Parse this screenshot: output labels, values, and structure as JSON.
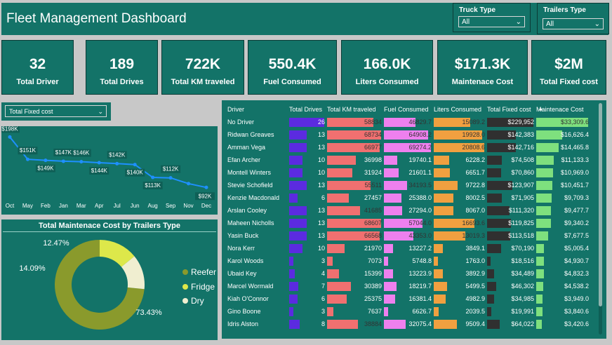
{
  "title": "Fleet Management Dashboard",
  "slicers": [
    {
      "label": "Truck Type",
      "value": "All"
    },
    {
      "label": "Trailers Type",
      "value": "All"
    }
  ],
  "cards": [
    {
      "value": "32",
      "label": "Total Driver"
    },
    {
      "value": "189",
      "label": "Total Drives"
    },
    {
      "value": "722K",
      "label": "Total  KM traveled"
    },
    {
      "value": "550.4K",
      "label": "Fuel Consumed"
    },
    {
      "value": "166.0K",
      "label": "Liters Consumed"
    },
    {
      "value": "$171.3K",
      "label": "Maintenace Cost"
    },
    {
      "value": "$2M",
      "label": "Total Fixed cost"
    }
  ],
  "measure_selector": {
    "value": "Total Fixed cost"
  },
  "chart_data": [
    {
      "type": "line",
      "categories": [
        "Oct",
        "May",
        "Feb",
        "Jan",
        "Mar",
        "Apr",
        "Jul",
        "Jun",
        "Aug",
        "Sep",
        "Nov",
        "Dec"
      ],
      "values": [
        198,
        151,
        149,
        147,
        146,
        144,
        142,
        140,
        113,
        112,
        100,
        92
      ],
      "data_labels": [
        "$198K",
        "$151K",
        "$149K",
        "$147K",
        "$146K",
        "$144K",
        "$142K",
        "$140K",
        "$113K",
        "$112K",
        "",
        "$92K"
      ],
      "color": "#1e90ff"
    },
    {
      "type": "pie",
      "title": "Total Maintenace Cost by Trailers Type",
      "categories": [
        "Reefer",
        "Fridge",
        "Dry"
      ],
      "values": [
        73.43,
        14.09,
        12.47
      ],
      "labels": [
        "73.43%",
        "14.09%",
        "12.47%"
      ],
      "colors": [
        "#8a9a2c",
        "#dde84a",
        "#f0eed0"
      ]
    }
  ],
  "table": {
    "headers": [
      "Driver",
      "Total Drives",
      "Total  KM traveled",
      "Fuel Consumed",
      "Liters Consumed",
      "Total Fixed cost",
      "Maintenace Cost"
    ],
    "colors": [
      "#5b2be0",
      "#f07070",
      "#ee80ee",
      "#f0a040",
      "#303030",
      "#7ee07e"
    ],
    "max": [
      26,
      68734,
      69274.2,
      20808.6,
      229952,
      33309.6
    ],
    "rows": [
      [
        "No Driver",
        "26",
        "58834",
        "46829.7",
        "15089.2",
        "$229,952",
        "$33,309.6"
      ],
      [
        "Ridwan Greaves",
        "13",
        "68734",
        "64908.2",
        "19928.0",
        "$142,383",
        "$16,626.4"
      ],
      [
        "Amman Vega",
        "13",
        "66977",
        "69274.2",
        "20808.6",
        "$142,716",
        "$14,465.8"
      ],
      [
        "Efan Archer",
        "10",
        "36998",
        "19740.1",
        "6228.2",
        "$74,508",
        "$11,133.3"
      ],
      [
        "Montell Winters",
        "10",
        "31924",
        "21601.1",
        "6651.7",
        "$70,860",
        "$10,969.0"
      ],
      [
        "Stevie Schofield",
        "13",
        "55511",
        "34193.5",
        "9722.8",
        "$123,907",
        "$10,451.7"
      ],
      [
        "Kenzie Macdonald",
        "6",
        "27457",
        "25388.0",
        "8002.5",
        "$71,905",
        "$9,709.3"
      ],
      [
        "Arslan Cooley",
        "13",
        "41685",
        "27294.0",
        "8067.0",
        "$111,320",
        "$9,477.7"
      ],
      [
        "Maheen Nicholls",
        "13",
        "68607",
        "57044.0",
        "16693.6",
        "$119,825",
        "$9,340.2"
      ],
      [
        "Yasin Buck",
        "13",
        "66568",
        "43353.0",
        "13019.3",
        "$113,518",
        "$7,677.5"
      ],
      [
        "Nora Kerr",
        "10",
        "21970",
        "13227.2",
        "3849.1",
        "$70,190",
        "$5,005.4"
      ],
      [
        "Karol Woods",
        "3",
        "7073",
        "5748.8",
        "1763.0",
        "$18,516",
        "$4,930.7"
      ],
      [
        "Ubaid Key",
        "4",
        "15399",
        "13223.9",
        "3892.9",
        "$34,489",
        "$4,832.3"
      ],
      [
        "Marcel Wormald",
        "7",
        "30389",
        "18219.7",
        "5499.5",
        "$46,302",
        "$4,538.2"
      ],
      [
        "Kiah O'Connor",
        "6",
        "25375",
        "16381.4",
        "4982.9",
        "$34,985",
        "$3,949.0"
      ],
      [
        "Gino Boone",
        "3",
        "7637",
        "6626.7",
        "2039.5",
        "$19,991",
        "$3,840.6"
      ],
      [
        "Idris Alston",
        "8",
        "38884",
        "32075.4",
        "9509.4",
        "$64,022",
        "$3,420.6"
      ]
    ]
  }
}
